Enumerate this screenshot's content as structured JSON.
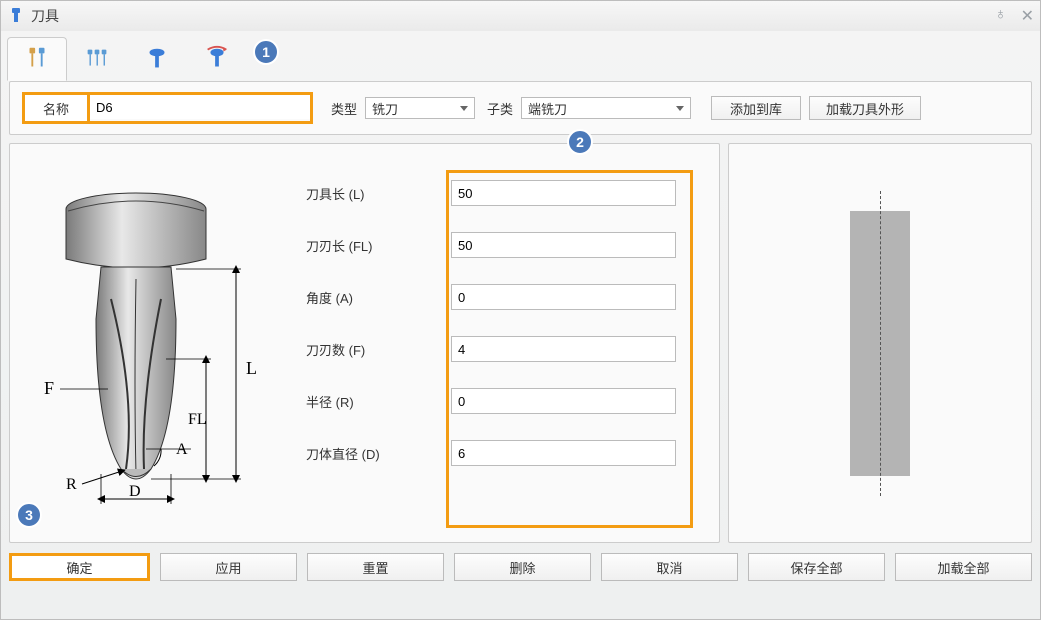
{
  "window": {
    "title": "刀具"
  },
  "callouts": {
    "c1": "1",
    "c2": "2",
    "c3": "3"
  },
  "topbar": {
    "name_label": "名称",
    "name_value": "D6",
    "type_label": "类型",
    "type_value": "铣刀",
    "subtype_label": "子类",
    "subtype_value": "端铣刀",
    "add_to_lib": "添加到库",
    "load_shape": "加载刀具外形"
  },
  "params": {
    "tool_length": {
      "label": "刀具长 (L)",
      "value": "50"
    },
    "flute_length": {
      "label": "刀刃长 (FL)",
      "value": "50"
    },
    "angle": {
      "label": "角度 (A)",
      "value": "0"
    },
    "flute_count": {
      "label": "刀刃数 (F)",
      "value": "4"
    },
    "radius": {
      "label": "半径 (R)",
      "value": "0"
    },
    "diameter": {
      "label": "刀体直径 (D)",
      "value": "6"
    }
  },
  "diagram_labels": {
    "F": "F",
    "R": "R",
    "D": "D",
    "A": "A",
    "FL": "FL",
    "L": "L"
  },
  "buttons": {
    "ok": "确定",
    "apply": "应用",
    "reset": "重置",
    "delete": "删除",
    "cancel": "取消",
    "save_all": "保存全部",
    "load_all": "加载全部"
  }
}
